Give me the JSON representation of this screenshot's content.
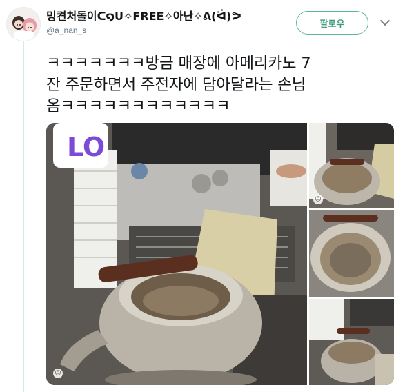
{
  "user": {
    "display_name": "밍켠처돌이ᑕ໑ᑌ✧FREE✧아난✧ᕕ(ᐛ)ᕗ",
    "handle": "@a_nan_s",
    "avatar_icon": "anime-avatar"
  },
  "follow": {
    "label": "팔로우"
  },
  "tweet": {
    "lines": [
      "ㅋㅋㅋㅋㅋㅋㅋ방금 매장에 아메리카노 7",
      "잔 주문하면서 주전자에 담아달라는 손님",
      "옴ㅋㅋㅋㅋㅋㅋㅋㅋㅋㅋㅋㅋ"
    ]
  },
  "media": {
    "photos": [
      {
        "id": "main",
        "subject": "kettle-on-espresso-counter"
      },
      {
        "id": "top-right",
        "subject": "kettle-top-view"
      },
      {
        "id": "middle-right",
        "subject": "kettle-inside-view"
      },
      {
        "id": "bottom-right",
        "subject": "kettle-on-floor"
      }
    ],
    "sign_text": "LO"
  },
  "colors": {
    "accent": "#59b89a",
    "thread_line": "#cdeee3",
    "text": "#14171a",
    "muted": "#657786"
  }
}
